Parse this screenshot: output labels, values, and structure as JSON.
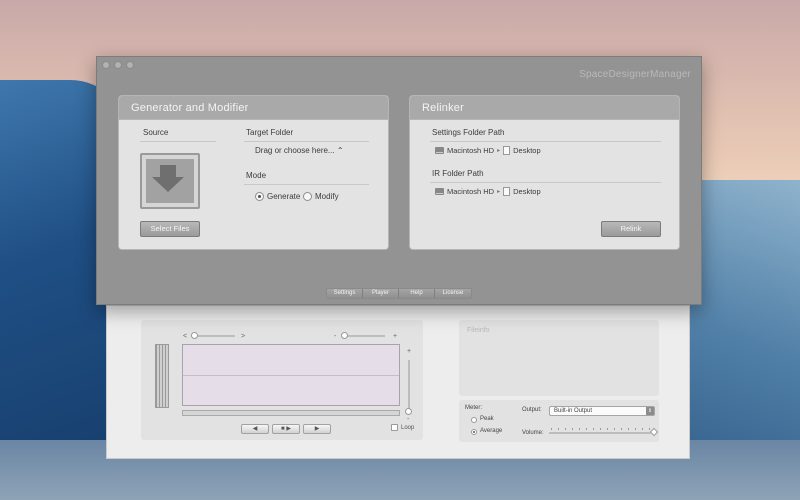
{
  "window": {
    "title": "SpaceDesignerManager"
  },
  "generator": {
    "title": "Generator and Modifier",
    "source_label": "Source",
    "target_folder_label": "Target Folder",
    "target_folder_value": "Drag or choose here... ⌃",
    "mode_label": "Mode",
    "mode_options": [
      "Generate",
      "Modify"
    ],
    "mode_selected": "Generate",
    "select_files_button": "Select Files"
  },
  "relinker": {
    "title": "Relinker",
    "settings_path_label": "Settings Folder Path",
    "ir_path_label": "IR Folder Path",
    "path_volume": "Macintosh HD",
    "path_separator": "▸",
    "path_folder": "Desktop",
    "relink_button": "Relink"
  },
  "bottom_tabs": [
    "Settings",
    "Player",
    "Help",
    "License"
  ],
  "player": {
    "scroll_left": "<",
    "scroll_right": ">",
    "zoom_minus": "-",
    "zoom_plus": "+",
    "vol_plus": "+",
    "vol_minus": "-",
    "transport": [
      "◀",
      "■ ▶",
      "▶"
    ],
    "loop_label": "Loop",
    "fileinfo_label": "Fileinfo",
    "meter_label": "Meter:",
    "meter_options": [
      "Peak",
      "Average"
    ],
    "meter_selected": "Average",
    "output_label": "Output:",
    "output_value": "Built-in Output",
    "volume_label": "Volume:"
  }
}
